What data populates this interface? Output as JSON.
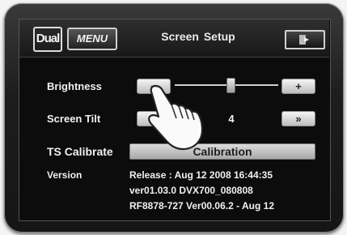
{
  "header": {
    "logo_text": "Dual",
    "menu_label": "MENU",
    "title": "Screen Setup",
    "exit_icon": "exit-icon"
  },
  "settings": {
    "brightness": {
      "label": "Brightness",
      "minus_label": "−",
      "plus_label": "+",
      "level_fraction": 0.55
    },
    "screen_tilt": {
      "label": "Screen Tilt",
      "left_label": "«",
      "right_label": "»",
      "value": "4"
    },
    "ts_calibrate": {
      "label": "TS Calibrate",
      "button_label": "Calibration"
    },
    "version": {
      "label": "Version",
      "lines": [
        "Release : Aug 12 2008    16:44:35",
        "ver01.03.0 DVX700_080808",
        "RF8878-727 Ver00.06.2 - Aug 12"
      ]
    }
  },
  "overlay": {
    "hand_icon": "pointing-hand-icon"
  },
  "colors": {
    "screen_bg": "#0c0c0c",
    "button_face": "#d8d8d8",
    "text": "#f0f0f0"
  }
}
